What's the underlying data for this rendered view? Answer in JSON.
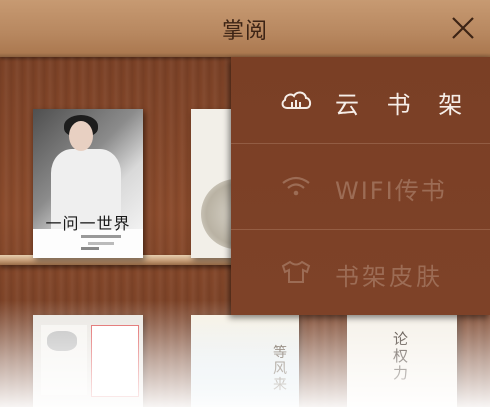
{
  "app": {
    "title": "掌阅"
  },
  "menu": {
    "items": [
      {
        "label": "云 书 架",
        "icon": "cloud-icon",
        "enabled": true
      },
      {
        "label": "WIFI传书",
        "icon": "wifi-icon",
        "enabled": false
      },
      {
        "label": "书架皮肤",
        "icon": "tshirt-icon",
        "enabled": false
      }
    ]
  },
  "books": [
    {
      "title": "一问一世界"
    },
    {
      "title": ""
    },
    {
      "title": ""
    },
    {
      "title": "等风来"
    },
    {
      "title": "论权力"
    }
  ],
  "colors": {
    "titlebar": "#b7875f",
    "wood": "#7b4126",
    "menu_bg": "#7a3f25",
    "menu_active_text": "#f6eee8",
    "menu_inactive_text": "#9c6c55"
  }
}
